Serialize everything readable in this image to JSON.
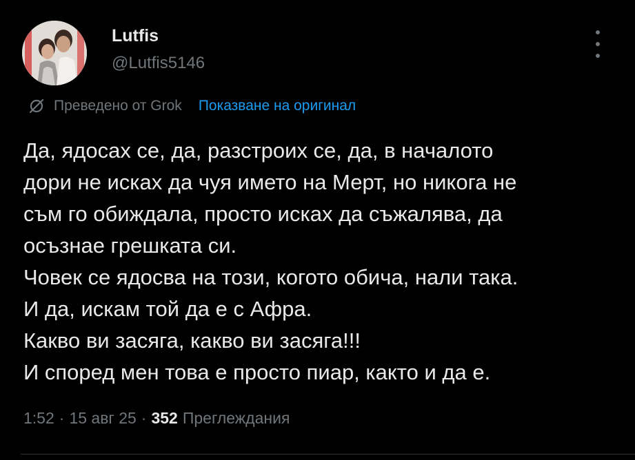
{
  "author": {
    "name": "Lutfis",
    "handle": "@Lutfis5146"
  },
  "translation": {
    "label": "Преведено от Grok",
    "show_original": "Показване на оригинал"
  },
  "tweet": {
    "lines": [
      "Да, ядосах се, да, разстроих се, да, в началото",
      "дори не исках да чуя името на Мерт, но никога не",
      "съм го обиждала, просто исках да съжалява, да",
      "осъзнае грешката си.",
      "Човек се ядосва на този, когото обича, нали така.",
      "И да, искам той да е с Афра.",
      "Какво ви засяга, какво ви засяга!!!",
      "И според мен това е просто пиар, както и да е."
    ]
  },
  "meta": {
    "time": "1:52",
    "date": "15 авг 25",
    "separator": "·",
    "views_count": "352",
    "views_label": "Преглеждания"
  },
  "icons": {
    "more": "more-vertical-icon",
    "translate": "grok-translate-icon"
  },
  "colors": {
    "background": "#000000",
    "text": "#e7e9ea",
    "secondary": "#71767b",
    "link": "#1d9bf0"
  }
}
